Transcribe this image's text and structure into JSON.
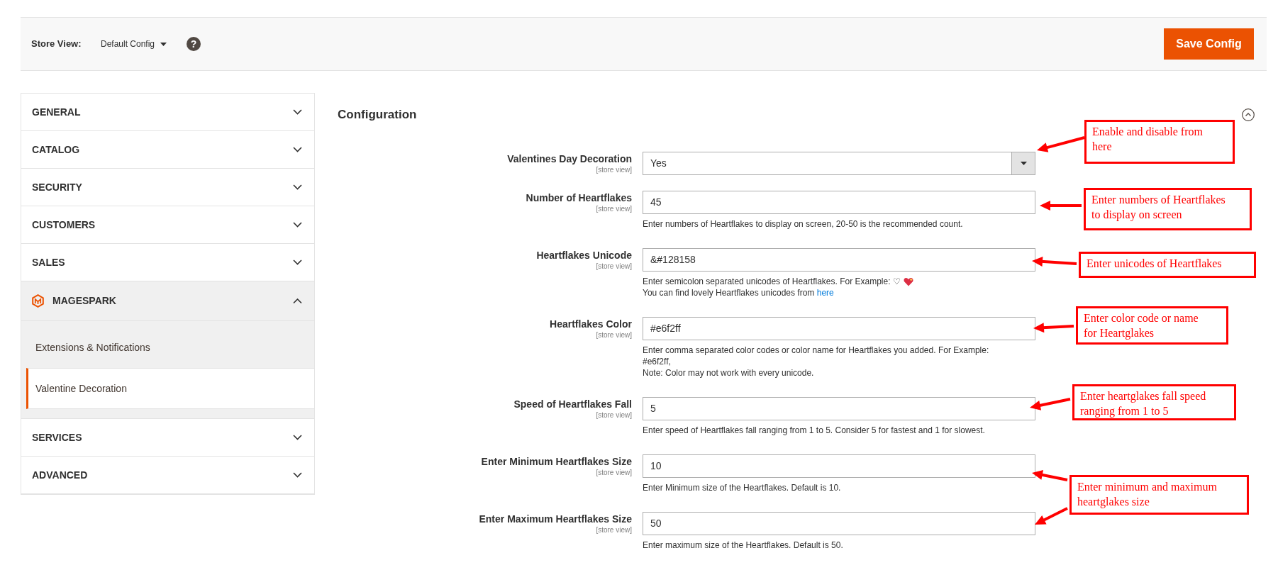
{
  "header": {
    "store_view_label": "Store View:",
    "store_view_value": "Default Config",
    "help": "?",
    "save_button": "Save Config"
  },
  "sidebar": {
    "sections": [
      {
        "label": "GENERAL",
        "kind": "plain",
        "expanded": false
      },
      {
        "label": "CATALOG",
        "kind": "plain",
        "expanded": false
      },
      {
        "label": "SECURITY",
        "kind": "plain",
        "expanded": false
      },
      {
        "label": "CUSTOMERS",
        "kind": "plain",
        "expanded": false
      },
      {
        "label": "SALES",
        "kind": "plain",
        "expanded": false
      },
      {
        "label": "MAGESPARK",
        "kind": "logo",
        "expanded": true,
        "children": [
          {
            "label": "Extensions & Notifications",
            "selected": false
          },
          {
            "label": "Valentine Decoration",
            "selected": true
          }
        ]
      },
      {
        "label": "SERVICES",
        "kind": "plain",
        "expanded": false
      },
      {
        "label": "ADVANCED",
        "kind": "plain",
        "expanded": false
      }
    ]
  },
  "section": {
    "title": "Configuration",
    "expanded": true,
    "fields": [
      {
        "kind": "select",
        "label": "Valentines Day Decoration",
        "scope": "[store view]",
        "value": "Yes"
      },
      {
        "kind": "text",
        "label": "Number of Heartflakes",
        "scope": "[store view]",
        "value": "45",
        "notes": [
          {
            "kind": "text",
            "lines": [
              "Enter numbers of Heartflakes to display on screen, 20-50 is the recommended count."
            ]
          }
        ]
      },
      {
        "kind": "text",
        "label": "Heartflakes Unicode",
        "scope": "[store view]",
        "value": "&#128158",
        "notes": [
          {
            "kind": "example",
            "lines": [
              "Enter semicolon separated unicodes of Heartflakes. For Example: ♡"
            ]
          },
          {
            "kind": "link",
            "lines": [
              "You can find lovely Heartflakes unicodes from"
            ],
            "link": "here"
          }
        ]
      },
      {
        "kind": "text",
        "label": "Heartflakes Color",
        "scope": "[store view]",
        "value": "#e6f2ff",
        "notes": [
          {
            "kind": "text",
            "lines": [
              "Enter comma separated color codes or color name for Heartflakes you added. For Example:",
              "#e6f2ff,"
            ]
          },
          {
            "kind": "text",
            "lines": [
              "Note: Color may not work with every unicode."
            ]
          }
        ]
      },
      {
        "kind": "text",
        "label": "Speed of Heartflakes Fall",
        "scope": "[store view]",
        "value": "5",
        "notes": [
          {
            "kind": "text",
            "lines": [
              "Enter speed of Heartflakes fall ranging from 1 to 5. Consider 5 for fastest and 1 for slowest."
            ]
          }
        ]
      },
      {
        "kind": "text",
        "label": "Enter Minimum Heartflakes Size",
        "scope": "[store view]",
        "value": "10",
        "notes": [
          {
            "kind": "text",
            "lines": [
              "Enter Minimum size of the Heartflakes. Default is 10."
            ]
          }
        ]
      },
      {
        "kind": "text",
        "label": "Enter Maximum Heartflakes Size",
        "scope": "[store view]",
        "value": "50",
        "notes": [
          {
            "kind": "text",
            "lines": [
              "Enter maximum size of the Heartflakes. Default is 50."
            ]
          }
        ]
      }
    ]
  },
  "annotations": [
    {
      "lines": [
        "Enable and disable from",
        "here"
      ]
    },
    {
      "lines": [
        "Enter numbers of Heartflakes",
        "to display on screen"
      ]
    },
    {
      "lines": [
        "Enter unicodes of Heartflakes"
      ]
    },
    {
      "lines": [
        "Enter color code or name",
        "for Heartglakes"
      ]
    },
    {
      "lines": [
        "Enter heartglakes fall speed",
        "ranging from 1 to 5"
      ]
    },
    {
      "lines": [
        "Enter minimum and maximum",
        "heartglakes size"
      ]
    }
  ]
}
